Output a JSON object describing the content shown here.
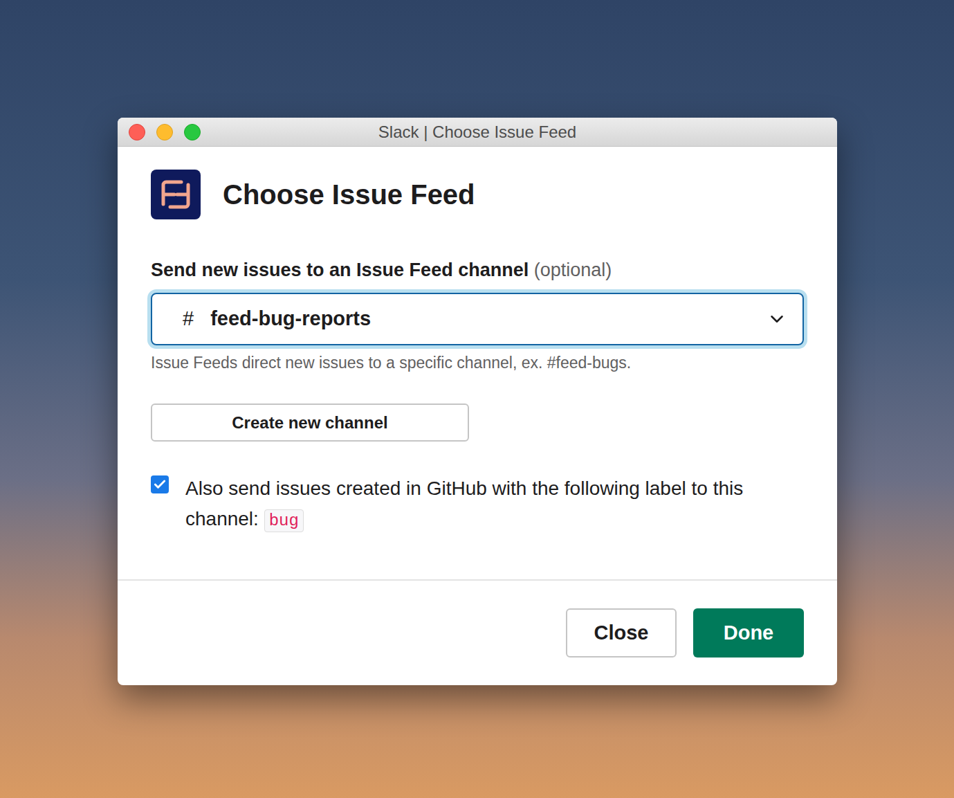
{
  "window": {
    "title": "Slack | Choose Issue Feed"
  },
  "dialog": {
    "title": "Choose Issue Feed",
    "field_label": "Send new issues to an Issue Feed channel",
    "field_hint": "(optional)",
    "select": {
      "prefix": "#",
      "value": "feed-bug-reports",
      "focused": true
    },
    "help_text": "Issue Feeds direct new issues to a specific channel, ex. #feed-bugs.",
    "create_button": "Create new channel",
    "checkbox": {
      "label": "Also send issues created in GitHub with the following label to this channel:",
      "checked": true,
      "tag": "bug"
    }
  },
  "buttons": [
    {
      "label": "Close",
      "primary": false
    },
    {
      "label": "Done",
      "primary": true
    }
  ]
}
